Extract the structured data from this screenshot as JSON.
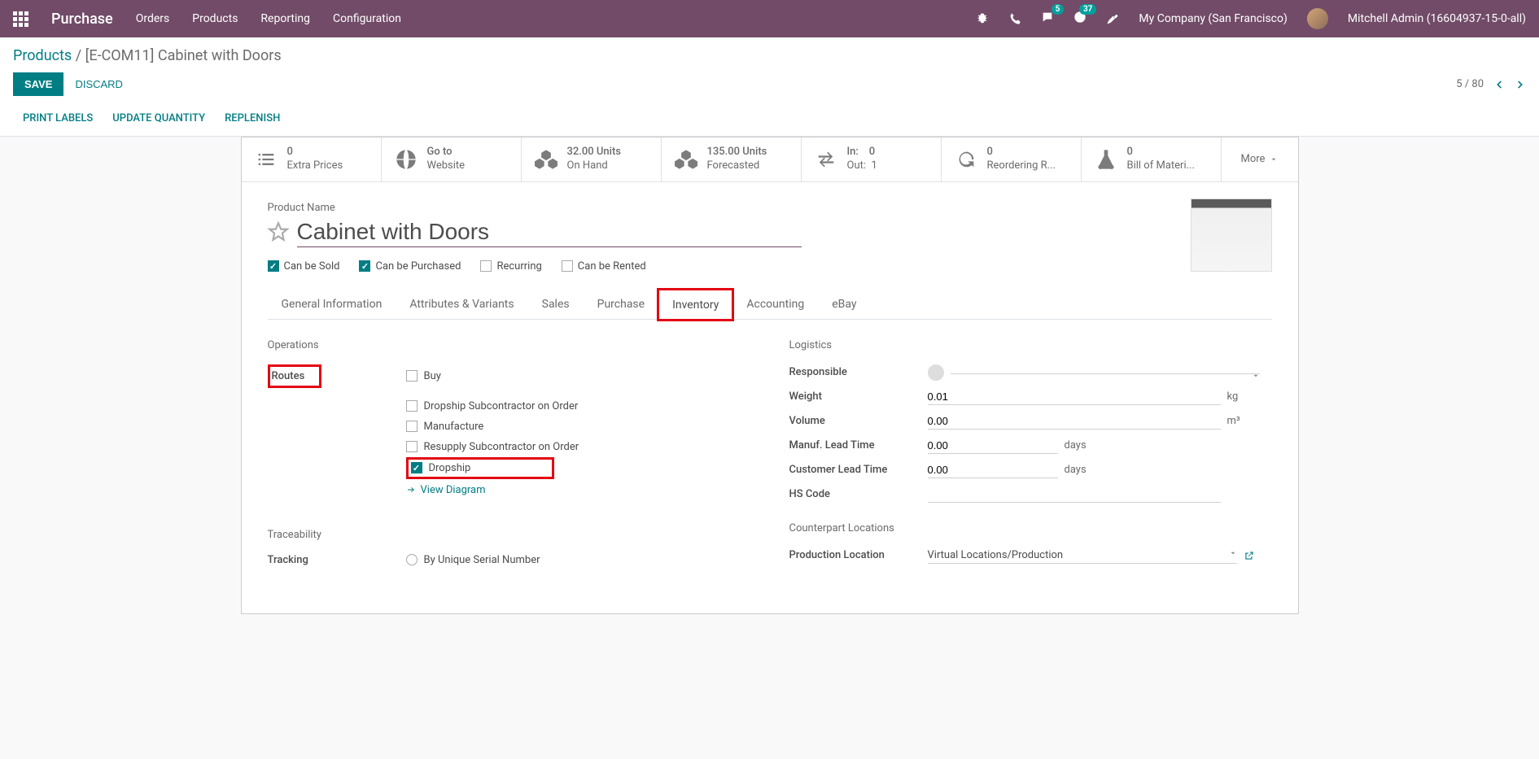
{
  "topbar": {
    "brand": "Purchase",
    "nav": [
      "Orders",
      "Products",
      "Reporting",
      "Configuration"
    ],
    "msg_count": "5",
    "activity_count": "37",
    "company": "My Company (San Francisco)",
    "user": "Mitchell Admin (16604937-15-0-all)"
  },
  "breadcrumb": {
    "parent": "Products",
    "current": "[E-COM11] Cabinet with Doors"
  },
  "actions": {
    "save": "SAVE",
    "discard": "DISCARD",
    "pager": "5 / 80"
  },
  "action_buttons": [
    "PRINT LABELS",
    "UPDATE QUANTITY",
    "REPLENISH"
  ],
  "stats": [
    {
      "val": "0",
      "label": "Extra Prices"
    },
    {
      "val": "Go to",
      "label": "Website"
    },
    {
      "val": "32.00 Units",
      "label": "On Hand"
    },
    {
      "val": "135.00 Units",
      "label": "Forecasted"
    },
    {
      "val": "In:    0",
      "label": "Out:  1"
    },
    {
      "val": "0",
      "label": "Reordering R..."
    },
    {
      "val": "0",
      "label": "Bill of Materi..."
    }
  ],
  "more": "More",
  "product": {
    "name_label": "Product Name",
    "name": "Cabinet with Doors",
    "can_be_sold": "Can be Sold",
    "can_be_purchased": "Can be Purchased",
    "recurring": "Recurring",
    "can_be_rented": "Can be Rented"
  },
  "tabs": [
    "General Information",
    "Attributes & Variants",
    "Sales",
    "Purchase",
    "Inventory",
    "Accounting",
    "eBay"
  ],
  "inventory": {
    "operations_title": "Operations",
    "routes_label": "Routes",
    "routes": [
      {
        "label": "Buy",
        "checked": false
      },
      {
        "label": "Dropship Subcontractor on Order",
        "checked": false
      },
      {
        "label": "Manufacture",
        "checked": false
      },
      {
        "label": "Resupply Subcontractor on Order",
        "checked": false
      },
      {
        "label": "Dropship",
        "checked": true
      }
    ],
    "view_diagram": "View Diagram",
    "traceability_title": "Traceability",
    "tracking_label": "Tracking",
    "tracking_opt": "By Unique Serial Number",
    "logistics_title": "Logistics",
    "responsible_label": "Responsible",
    "weight_label": "Weight",
    "weight_val": "0.01",
    "weight_unit": "kg",
    "volume_label": "Volume",
    "volume_val": "0.00",
    "volume_unit": "m³",
    "manuf_lead_label": "Manuf. Lead Time",
    "manuf_lead_val": "0.00",
    "cust_lead_label": "Customer Lead Time",
    "cust_lead_val": "0.00",
    "days_unit": "days",
    "hs_label": "HS Code",
    "counterpart_title": "Counterpart Locations",
    "prod_loc_label": "Production Location",
    "prod_loc_val": "Virtual Locations/Production"
  }
}
